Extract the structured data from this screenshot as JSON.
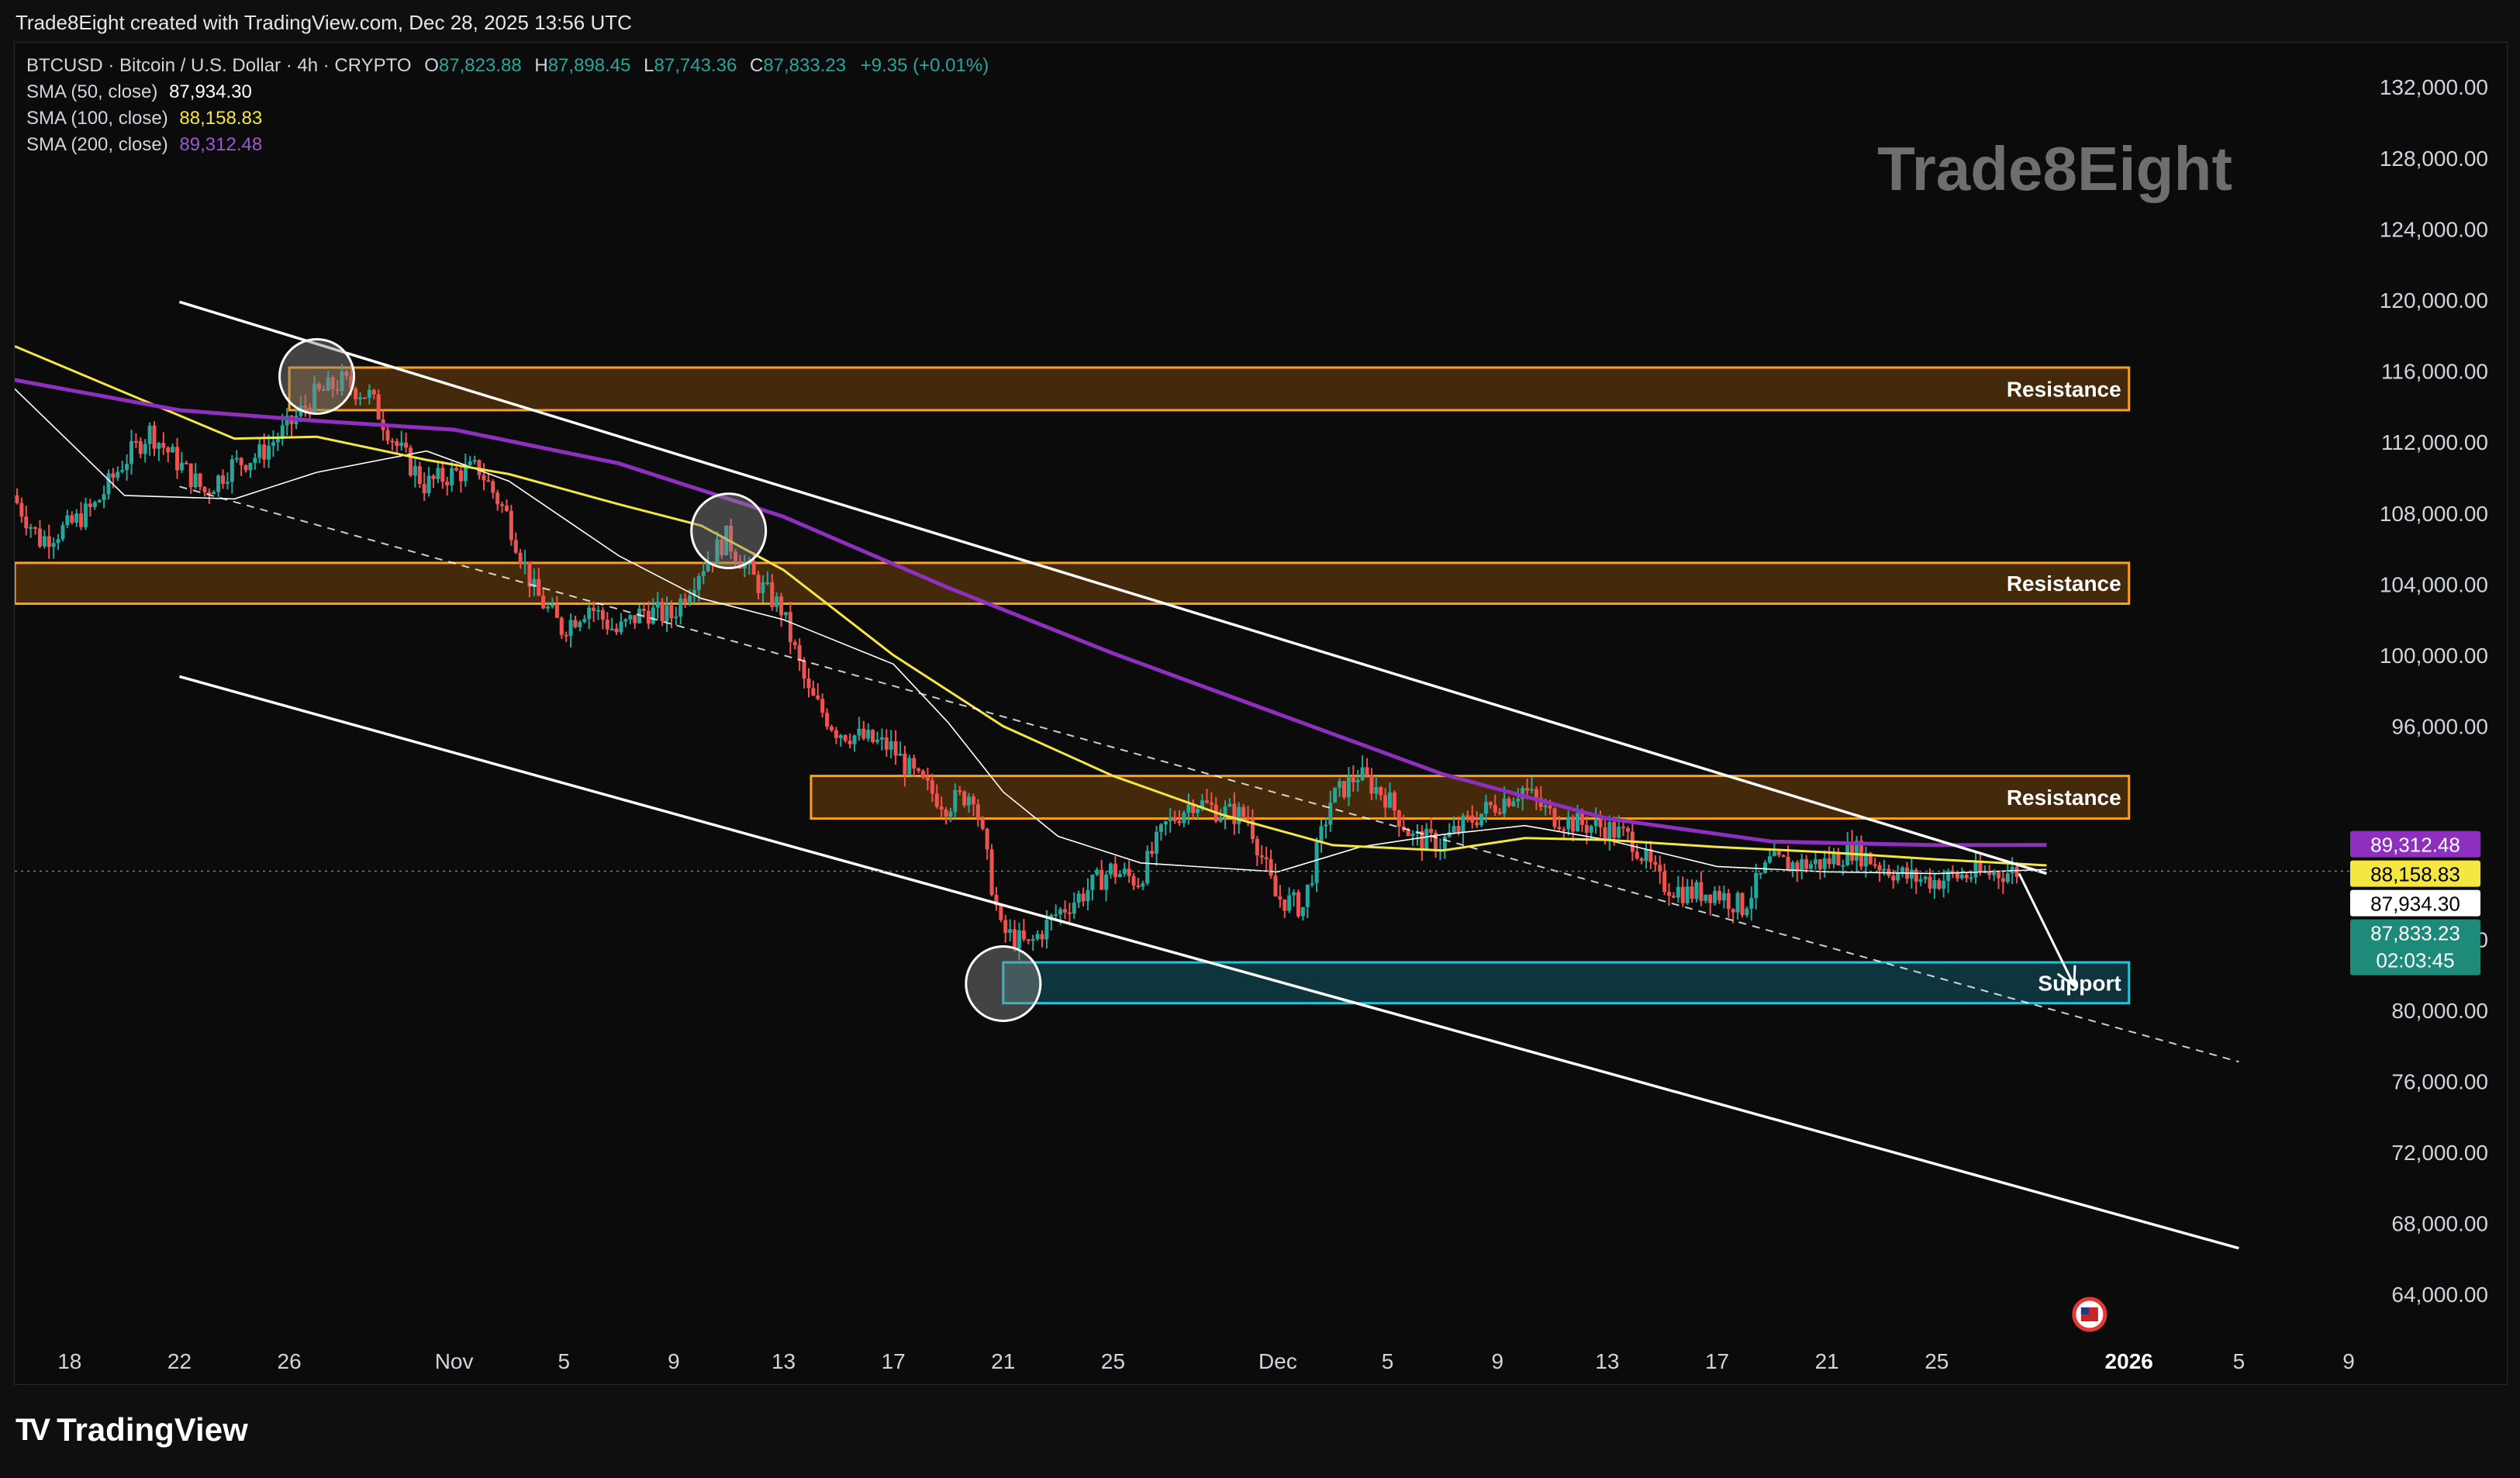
{
  "header": {
    "caption": "Trade8Eight created with TradingView.com, Dec 28, 2025 13:56 UTC"
  },
  "legend": {
    "symbol": "BTCUSD · Bitcoin / U.S. Dollar · 4h · CRYPTO",
    "o_label": "O",
    "o_value": "87,823.88",
    "h_label": "H",
    "h_value": "87,898.45",
    "l_label": "L",
    "l_value": "87,743.36",
    "c_label": "C",
    "c_value": "87,833.23",
    "change": "+9.35 (+0.01%)",
    "sma50_label": "SMA (50, close)",
    "sma50_value": "87,934.30",
    "sma100_label": "SMA (100, close)",
    "sma100_value": "88,158.83",
    "sma200_label": "SMA (200, close)",
    "sma200_value": "89,312.48"
  },
  "footer": {
    "brand": "TradingView",
    "brand_mark": "TV"
  },
  "colors": {
    "background": "#0b0b0b",
    "up": "#26a69a",
    "down": "#ef5350",
    "sma50": "#ffffff",
    "sma100": "#f5e642",
    "sma200": "#8e2fbf",
    "resistance": "#f7a21b",
    "support": "#26c6da"
  },
  "chart_data": {
    "type": "candlestick",
    "watermark": "Trade8Eight",
    "y_ticks": [
      "132,000.00",
      "128,000.00",
      "124,000.00",
      "120,000.00",
      "116,000.00",
      "112,000.00",
      "108,000.00",
      "104,000.00",
      "100,000.00",
      "96,000.00",
      "84,000.00",
      "80,000.00",
      "76,000.00",
      "72,000.00",
      "68,000.00",
      "64,000.00"
    ],
    "y_tick_values": [
      132000,
      128000,
      124000,
      120000,
      116000,
      112000,
      108000,
      104000,
      100000,
      96000,
      84000,
      80000,
      76000,
      72000,
      68000,
      64000
    ],
    "ylim": [
      62000,
      134500
    ],
    "x_ticks": [
      {
        "label": "18",
        "date": "2025-10-18"
      },
      {
        "label": "22",
        "date": "2025-10-22"
      },
      {
        "label": "26",
        "date": "2025-10-26"
      },
      {
        "label": "Nov",
        "date": "2025-11-01"
      },
      {
        "label": "5",
        "date": "2025-11-05"
      },
      {
        "label": "9",
        "date": "2025-11-09"
      },
      {
        "label": "13",
        "date": "2025-11-13"
      },
      {
        "label": "17",
        "date": "2025-11-17"
      },
      {
        "label": "21",
        "date": "2025-11-21"
      },
      {
        "label": "25",
        "date": "2025-11-25"
      },
      {
        "label": "Dec",
        "date": "2025-12-01"
      },
      {
        "label": "5",
        "date": "2025-12-05"
      },
      {
        "label": "9",
        "date": "2025-12-09"
      },
      {
        "label": "13",
        "date": "2025-12-13"
      },
      {
        "label": "17",
        "date": "2025-12-17"
      },
      {
        "label": "21",
        "date": "2025-12-21"
      },
      {
        "label": "25",
        "date": "2025-12-25"
      },
      {
        "label": "2026",
        "date": "2026-01-01"
      },
      {
        "label": "5",
        "date": "2026-01-05"
      },
      {
        "label": "9",
        "date": "2026-01-09"
      }
    ],
    "xlim": [
      "2025-10-16",
      "2026-01-09"
    ],
    "price_path": [
      [
        "2025-10-16",
        109000
      ],
      [
        "2025-10-17",
        106500
      ],
      [
        "2025-10-18",
        107200
      ],
      [
        "2025-10-19",
        108400
      ],
      [
        "2025-10-20",
        110800
      ],
      [
        "2025-10-21",
        112600
      ],
      [
        "2025-10-22",
        110900
      ],
      [
        "2025-10-23",
        109200
      ],
      [
        "2025-10-24",
        110700
      ],
      [
        "2025-10-25",
        111300
      ],
      [
        "2025-10-26",
        112800
      ],
      [
        "2025-10-27",
        114600
      ],
      [
        "2025-10-28",
        115400
      ],
      [
        "2025-10-29",
        114600
      ],
      [
        "2025-10-30",
        111800
      ],
      [
        "2025-10-31",
        109600
      ],
      [
        "2025-11-01",
        110200
      ],
      [
        "2025-11-02",
        110500
      ],
      [
        "2025-11-03",
        107900
      ],
      [
        "2025-11-04",
        103600
      ],
      [
        "2025-11-05",
        101500
      ],
      [
        "2025-11-06",
        102800
      ],
      [
        "2025-11-07",
        101300
      ],
      [
        "2025-11-08",
        102500
      ],
      [
        "2025-11-09",
        102200
      ],
      [
        "2025-11-10",
        104800
      ],
      [
        "2025-11-11",
        106600
      ],
      [
        "2025-11-12",
        104300
      ],
      [
        "2025-11-13",
        102600
      ],
      [
        "2025-11-14",
        97800
      ],
      [
        "2025-11-15",
        95800
      ],
      [
        "2025-11-16",
        95300
      ],
      [
        "2025-11-17",
        94800
      ],
      [
        "2025-11-18",
        92900
      ],
      [
        "2025-11-19",
        91600
      ],
      [
        "2025-11-20",
        92300
      ],
      [
        "2025-11-21",
        84500
      ],
      [
        "2025-11-22",
        83600
      ],
      [
        "2025-11-23",
        85400
      ],
      [
        "2025-11-24",
        86600
      ],
      [
        "2025-11-25",
        87900
      ],
      [
        "2025-11-26",
        87300
      ],
      [
        "2025-11-27",
        90400
      ],
      [
        "2025-11-28",
        91800
      ],
      [
        "2025-11-29",
        91200
      ],
      [
        "2025-11-30",
        90900
      ],
      [
        "2025-12-01",
        86400
      ],
      [
        "2025-12-02",
        85800
      ],
      [
        "2025-12-03",
        91800
      ],
      [
        "2025-12-04",
        93300
      ],
      [
        "2025-12-05",
        92100
      ],
      [
        "2025-12-06",
        89700
      ],
      [
        "2025-12-07",
        89400
      ],
      [
        "2025-12-08",
        90600
      ],
      [
        "2025-12-09",
        91600
      ],
      [
        "2025-12-10",
        92500
      ],
      [
        "2025-12-11",
        91000
      ],
      [
        "2025-12-12",
        90500
      ],
      [
        "2025-12-13",
        90300
      ],
      [
        "2025-12-14",
        89600
      ],
      [
        "2025-12-15",
        87200
      ],
      [
        "2025-12-16",
        86600
      ],
      [
        "2025-12-17",
        86700
      ],
      [
        "2025-12-18",
        85800
      ],
      [
        "2025-12-19",
        88300
      ],
      [
        "2025-12-20",
        88200
      ],
      [
        "2025-12-21",
        88300
      ],
      [
        "2025-12-22",
        89100
      ],
      [
        "2025-12-23",
        88200
      ],
      [
        "2025-12-24",
        87500
      ],
      [
        "2025-12-25",
        87300
      ],
      [
        "2025-12-26",
        87600
      ],
      [
        "2025-12-27",
        87700
      ],
      [
        "2025-12-28",
        87833
      ]
    ],
    "sma": [
      {
        "name": "SMA (50, close)",
        "color": "#ffffff",
        "points": [
          [
            "2025-10-16",
            115000
          ],
          [
            "2025-10-20",
            109000
          ],
          [
            "2025-10-24",
            108800
          ],
          [
            "2025-10-27",
            110300
          ],
          [
            "2025-10-31",
            111500
          ],
          [
            "2025-11-03",
            109800
          ],
          [
            "2025-11-07",
            105600
          ],
          [
            "2025-11-10",
            103200
          ],
          [
            "2025-11-13",
            102000
          ],
          [
            "2025-11-17",
            99500
          ],
          [
            "2025-11-19",
            96200
          ],
          [
            "2025-11-21",
            92300
          ],
          [
            "2025-11-23",
            89800
          ],
          [
            "2025-11-26",
            88300
          ],
          [
            "2025-12-01",
            87800
          ],
          [
            "2025-12-04",
            89200
          ],
          [
            "2025-12-07",
            89900
          ],
          [
            "2025-12-10",
            90400
          ],
          [
            "2025-12-13",
            89600
          ],
          [
            "2025-12-17",
            88100
          ],
          [
            "2025-12-21",
            87800
          ],
          [
            "2025-12-25",
            87700
          ],
          [
            "2025-12-29",
            87934
          ]
        ]
      },
      {
        "name": "SMA (100, close)",
        "color": "#f5e642",
        "points": [
          [
            "2025-10-16",
            117400
          ],
          [
            "2025-10-20",
            114800
          ],
          [
            "2025-10-24",
            112200
          ],
          [
            "2025-10-27",
            112300
          ],
          [
            "2025-10-31",
            111000
          ],
          [
            "2025-11-03",
            110200
          ],
          [
            "2025-11-07",
            108500
          ],
          [
            "2025-11-10",
            107300
          ],
          [
            "2025-11-13",
            104800
          ],
          [
            "2025-11-17",
            100000
          ],
          [
            "2025-11-21",
            96000
          ],
          [
            "2025-11-25",
            93200
          ],
          [
            "2025-11-29",
            91000
          ],
          [
            "2025-12-03",
            89300
          ],
          [
            "2025-12-07",
            89000
          ],
          [
            "2025-12-10",
            89700
          ],
          [
            "2025-12-13",
            89600
          ],
          [
            "2025-12-17",
            89200
          ],
          [
            "2025-12-21",
            88900
          ],
          [
            "2025-12-25",
            88500
          ],
          [
            "2025-12-29",
            88159
          ]
        ]
      },
      {
        "name": "SMA (200, close)",
        "color": "#8e2fbf",
        "points": [
          [
            "2025-10-16",
            115500
          ],
          [
            "2025-10-22",
            113800
          ],
          [
            "2025-10-27",
            113200
          ],
          [
            "2025-11-01",
            112700
          ],
          [
            "2025-11-07",
            110800
          ],
          [
            "2025-11-13",
            107800
          ],
          [
            "2025-11-19",
            103800
          ],
          [
            "2025-11-25",
            100100
          ],
          [
            "2025-12-01",
            96700
          ],
          [
            "2025-12-07",
            93300
          ],
          [
            "2025-12-13",
            90800
          ],
          [
            "2025-12-19",
            89500
          ],
          [
            "2025-12-25",
            89300
          ],
          [
            "2025-12-29",
            89312
          ]
        ]
      }
    ],
    "zones": [
      {
        "label": "Resistance",
        "kind": "resistance",
        "from": "2025-10-26",
        "to": "2026-01-01",
        "low": 113800,
        "high": 116200
      },
      {
        "label": "Resistance",
        "kind": "resistance",
        "from": "2025-10-16",
        "to": "2026-01-01",
        "low": 102900,
        "high": 105200
      },
      {
        "label": "Resistance",
        "kind": "resistance",
        "from": "2025-11-14",
        "to": "2026-01-01",
        "low": 90800,
        "high": 93200
      },
      {
        "label": "Support",
        "kind": "support",
        "from": "2025-11-21",
        "to": "2026-01-01",
        "low": 80400,
        "high": 82700
      }
    ],
    "trendlines": [
      {
        "name": "channel-upper",
        "style": "solid",
        "from": [
          "2025-10-22",
          119900
        ],
        "to": [
          "2025-12-29",
          87700
        ]
      },
      {
        "name": "channel-lower",
        "style": "solid",
        "from": [
          "2025-10-22",
          98800
        ],
        "to": [
          "2026-01-05",
          66600
        ]
      },
      {
        "name": "channel-mid",
        "style": "dashed",
        "from": [
          "2025-10-22",
          109500
        ],
        "to": [
          "2026-01-05",
          77100
        ]
      }
    ],
    "projection_arrow": {
      "from": [
        "2025-12-28",
        87700
      ],
      "to": [
        "2025-12-30",
        81400
      ]
    },
    "highlight_circles": [
      [
        "2025-10-27",
        115700
      ],
      [
        "2025-11-11",
        107000
      ],
      [
        "2025-11-21",
        81500
      ]
    ],
    "price_labels": [
      {
        "text": "89,312.48",
        "value": 89312.48,
        "bg": "#8e2fbf",
        "fg": "#ffffff"
      },
      {
        "text": "88,158.83",
        "value": 88158.83,
        "bg": "#f5e642",
        "fg": "#000000"
      },
      {
        "text": "87,934.30",
        "value": 87934.3,
        "bg": "#ffffff",
        "fg": "#000000"
      },
      {
        "text": "87,833.23",
        "value": 87833.23,
        "bg": "#1e8a7a",
        "fg": "#ffffff",
        "sub": "02:03:45"
      }
    ],
    "last_price": 87833.23
  }
}
